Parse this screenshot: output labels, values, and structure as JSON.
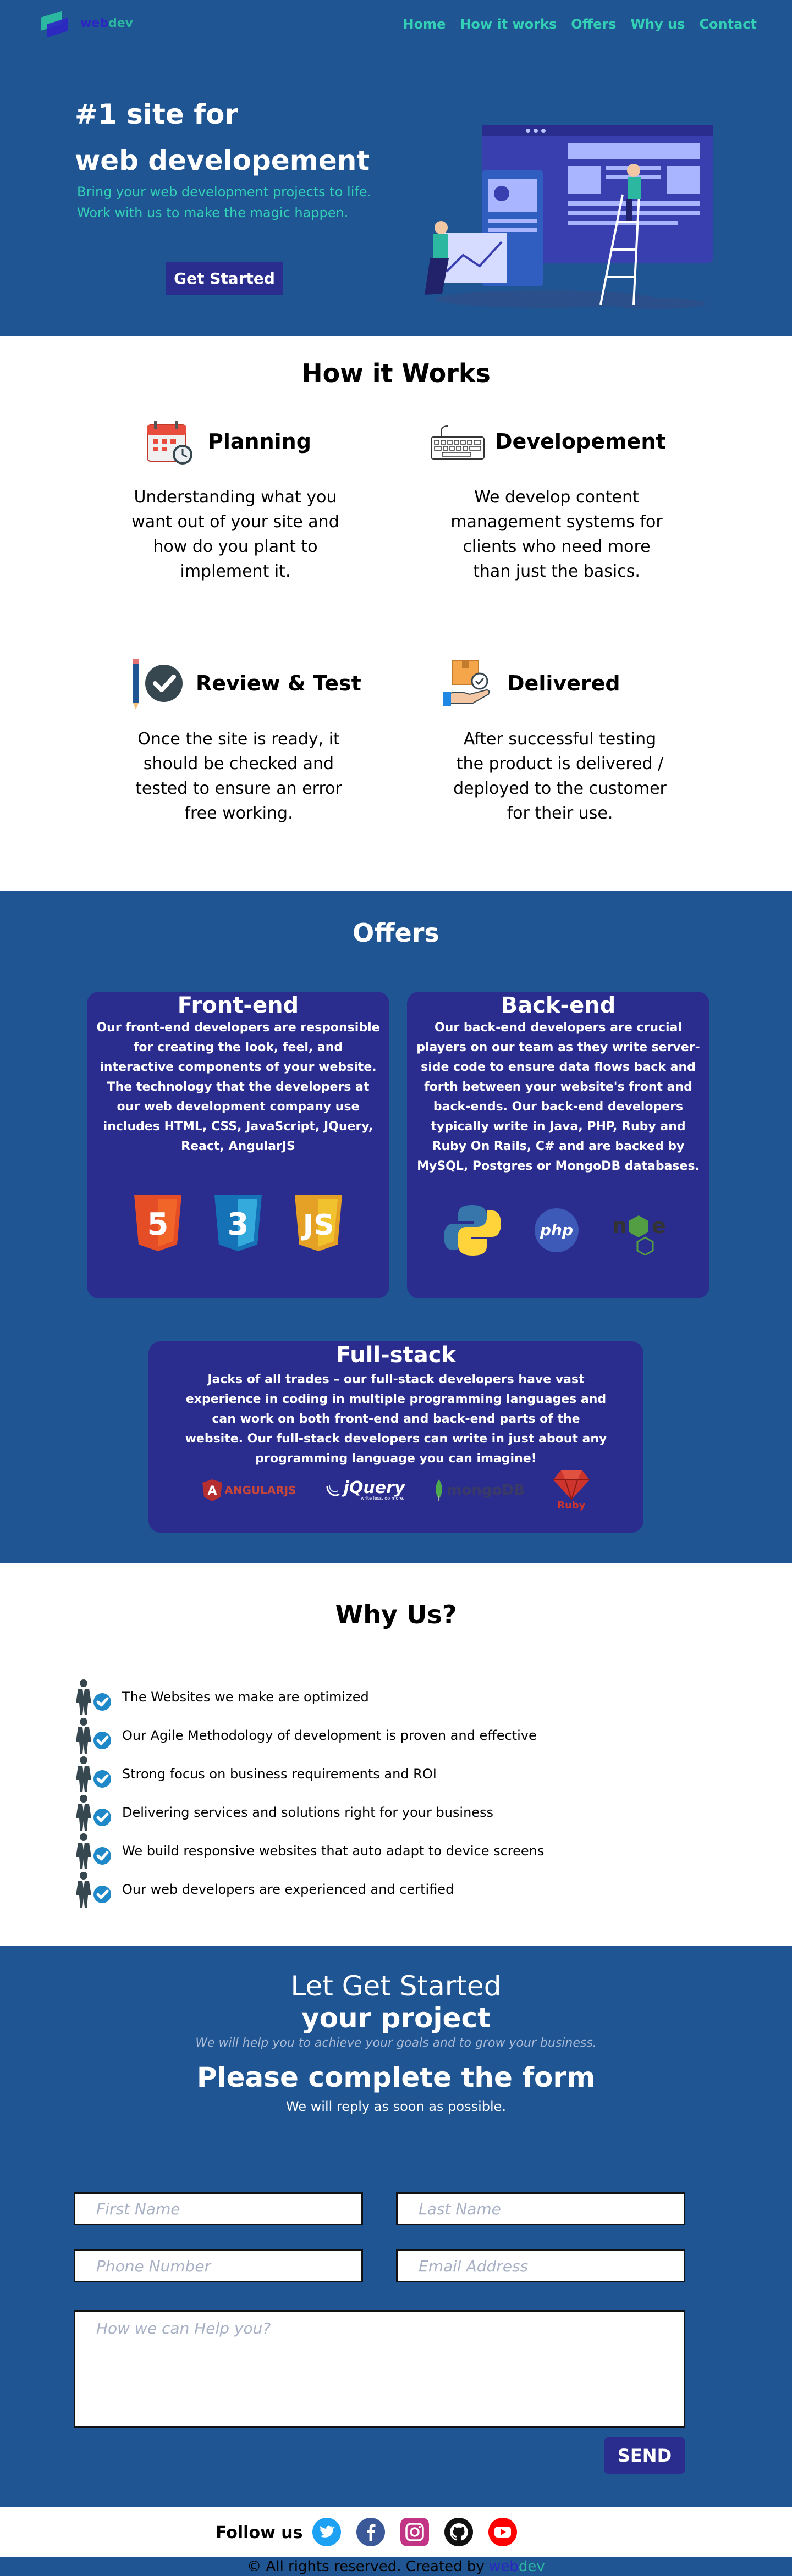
{
  "brand": {
    "web": "web",
    "dev": "dev"
  },
  "nav": [
    "Home",
    "How it works",
    "Offers",
    "Why us",
    "Contact"
  ],
  "hero": {
    "title_line1": "#1 site for",
    "title_line2": "web developement",
    "sub_line1": "Bring your web development projects to life.",
    "sub_line2": "Work with us to make the magic happen.",
    "cta": "Get Started"
  },
  "how": {
    "title": "How it Works",
    "steps": [
      {
        "name": "Planning",
        "icon": "calendar-icon",
        "desc": "Understanding what you want out of your site and how do you plant to implement it."
      },
      {
        "name": "Developement",
        "icon": "keyboard-icon",
        "desc": "We develop content management systems for clients who need more than just the basics."
      },
      {
        "name": "Review & Test",
        "icon": "pencil-check-icon",
        "desc": "Once the site is ready, it should be checked and tested to ensure an error free working."
      },
      {
        "name": "Delivered",
        "icon": "package-hand-icon",
        "desc": "After successful testing the product is delivered / deployed to the customer for their use."
      }
    ]
  },
  "offers": {
    "title": "Offers",
    "frontend": {
      "title": "Front-end",
      "p1": "Our front-end developers are responsible for creating the look, feel, and interactive components of your website.",
      "p2": "The technology that the developers at our web development company use includes HTML, CSS, JavaScript, JQuery, React, AngularJS"
    },
    "backend": {
      "title": "Back-end",
      "p1": "Our back-end developers are crucial players on our team as they write server-side code to ensure data flows back and forth between your website's front and back-ends. Our back-end developers typically write in Java, PHP, Ruby and Ruby On Rails, C# and are backed by MySQL, Postgres or MongoDB databases."
    },
    "fullstack": {
      "title": "Full-stack",
      "p1": "Jacks of all trades – our full-stack developers have vast experience in coding in multiple programming languages and can work on both front-end and back-end parts of the website. Our full-stack developers can write in just about any programming language you can imagine!",
      "logos": {
        "angular": "ANGULARJS",
        "jquery": "jQuery",
        "jquery_tag": "write less, do more.",
        "mongo": "mongoDB",
        "ruby": "Ruby",
        "php": "php"
      }
    }
  },
  "why": {
    "title": "Why Us?",
    "items": [
      "The Websites we make are optimized",
      "Our Agile Methodology of development is proven and effective",
      "Strong focus on business requirements and ROI",
      "Delivering services and solutions right for your business",
      "We build responsive websites that auto adapt to device screens",
      "Our web developers are experienced and certified"
    ]
  },
  "form": {
    "title1": "Let Get Started",
    "title2": "your project",
    "sub1": "We will help you to achieve your goals and to grow your business.",
    "title3": "Please complete the form",
    "sub2": "We will reply as soon as possible.",
    "first_name": "First Name",
    "last_name": "Last Name",
    "phone": "Phone Number",
    "email": "Email Address",
    "message": "How we can Help you?",
    "send": "SEND"
  },
  "footer": {
    "follow": "Follow us",
    "copy": "© All rights reserved. Created by ",
    "web": "web",
    "dev": "dev"
  },
  "colors": {
    "blue": "#1e5592",
    "navy": "#2a2d8e",
    "teal": "#34d0b6"
  }
}
